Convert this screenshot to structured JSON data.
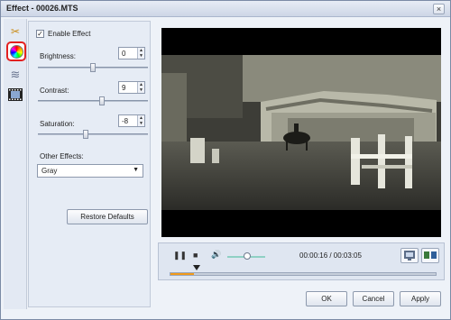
{
  "window": {
    "title": "Effect - 00026.MTS",
    "close_label": "×"
  },
  "toolbar": {
    "tools": [
      {
        "icon": "scissors-icon",
        "glyph": "✂"
      },
      {
        "icon": "color-wheel-icon",
        "glyph": ""
      },
      {
        "icon": "watermark-icon",
        "glyph": "≋"
      },
      {
        "icon": "film-strip-icon",
        "glyph": "🎞"
      }
    ]
  },
  "effect": {
    "enable_label": "Enable Effect",
    "enable_checked": "✓",
    "brightness_label": "Brightness:",
    "brightness_value": "0",
    "contrast_label": "Contrast:",
    "contrast_value": "9",
    "saturation_label": "Saturation:",
    "saturation_value": "-8",
    "other_effects_label": "Other Effects:",
    "other_effects_value": "Gray",
    "restore_label": "Restore Defaults"
  },
  "player": {
    "pause_glyph": "❚❚",
    "stop_glyph": "■",
    "volume_glyph": "🔊",
    "time": "00:00:16 / 00:03:05",
    "progress_fraction": 0.09
  },
  "footer": {
    "ok_label": "OK",
    "cancel_label": "Cancel",
    "apply_label": "Apply"
  },
  "colors": {
    "accent_red": "#e32020",
    "progress_orange": "#f29b1b",
    "volume_teal": "#8fd0c4"
  }
}
